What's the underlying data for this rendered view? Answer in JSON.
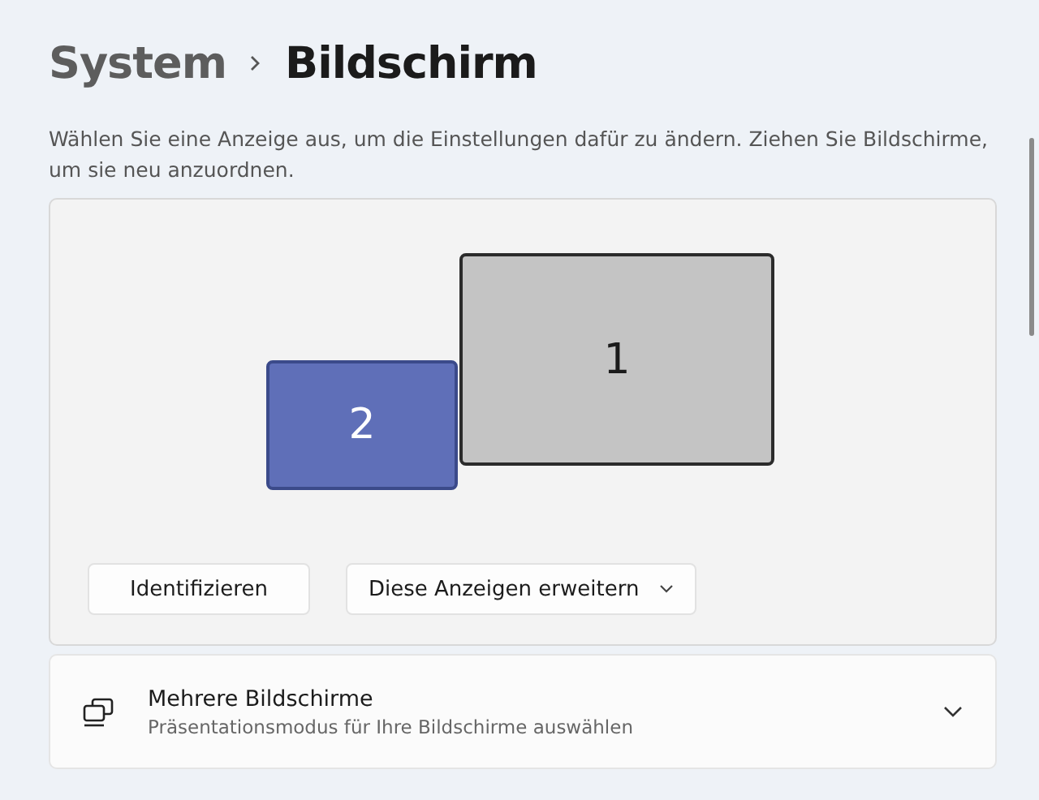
{
  "breadcrumb": {
    "parent": "System",
    "current": "Bildschirm"
  },
  "description": "Wählen Sie eine Anzeige aus, um die Einstellungen dafür zu ändern. Ziehen Sie Bildschirme, um sie neu anzuordnen.",
  "displays": [
    {
      "label": "1",
      "selected": false
    },
    {
      "label": "2",
      "selected": true
    }
  ],
  "identify_button": "Identifizieren",
  "mode_dropdown": {
    "value": "Diese Anzeigen erweitern"
  },
  "settings": [
    {
      "title": "Mehrere Bildschirme",
      "subtitle": "Präsentationsmodus für Ihre Bildschirme auswählen",
      "expanded": false
    }
  ]
}
